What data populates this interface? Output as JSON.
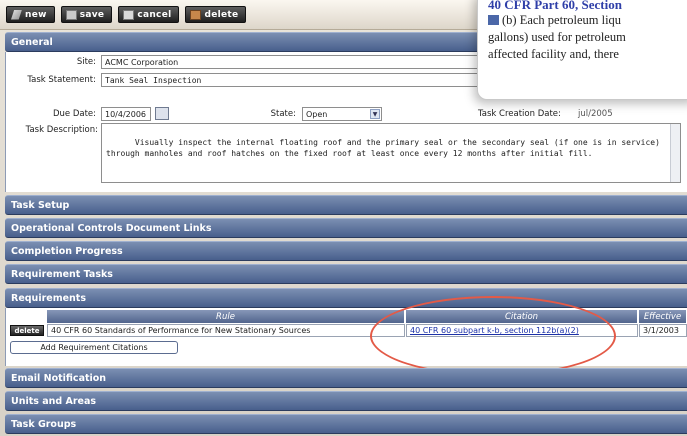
{
  "toolbar": {
    "new_label": "new",
    "save_label": "save",
    "cancel_label": "cancel",
    "delete_label": "delete"
  },
  "sections": {
    "general": "General",
    "task_setup": "Task Setup",
    "op_controls": "Operational Controls Document Links",
    "completion": "Completion Progress",
    "req_tasks": "Requirement Tasks",
    "requirements": "Requirements",
    "email": "Email Notification",
    "units": "Units and Areas",
    "task_groups": "Task Groups"
  },
  "general": {
    "site_label": "Site:",
    "site_value": "ACMC Corporation",
    "task_statement_label": "Task Statement:",
    "task_statement_value": "Tank Seal Inspection",
    "due_date_label": "Due Date:",
    "due_date_value": "10/4/2006",
    "state_label": "State:",
    "state_value": "Open",
    "task_creation_label": "Task Creation Date:",
    "task_creation_value": "jul/2005",
    "task_description_label": "Task Description:",
    "task_description_value": "Visually inspect the internal floating roof and the primary seal or the secondary seal (if one is in service) through manholes and roof hatches on the fixed roof at least once every 12 months after initial fill."
  },
  "requirements": {
    "columns": {
      "rule": "Rule",
      "citation": "Citation",
      "effective": "Effective"
    },
    "row": {
      "delete_label": "delete",
      "rule": "40 CFR 60 Standards of Performance for New Stationary Sources",
      "citation": "40 CFR 60 subpart k-b, section 112b(a)(2)",
      "effective": "3/1/2003"
    },
    "add_button": "Add Requirement Citations"
  },
  "tooltip": {
    "title": "40 CFR Part 60, Section",
    "line1": "(b) Each petroleum liqu",
    "line2": "gallons) used for petroleum",
    "line3": "affected facility and, there"
  },
  "colors": {
    "section_bar": "#5a6f99",
    "link": "#1d32a8",
    "highlight_ellipse": "#e35a47"
  }
}
